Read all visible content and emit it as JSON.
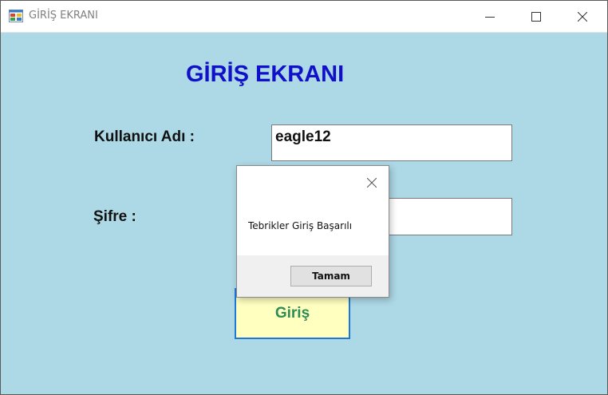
{
  "window": {
    "title": "GİRİŞ EKRANI",
    "icon": "windows-form-icon",
    "controls": [
      "minimize-icon",
      "maximize-icon",
      "close-icon"
    ]
  },
  "form": {
    "heading": "GİRİŞ EKRANI",
    "username_label": "Kullanıcı Adı :",
    "username_value": "eagle12",
    "password_label": "Şifre :",
    "password_value": "",
    "login_button": "Giriş"
  },
  "dialog": {
    "message": "Tebrikler Giriş Başarılı",
    "ok_button": "Tamam",
    "close_icon": "close-icon"
  },
  "colors": {
    "form_background": "#add8e6",
    "heading": "#1010c8",
    "login_button_bg": "#ffffc0",
    "login_button_text": "#2e8b57",
    "login_button_border": "#1e78d8"
  }
}
